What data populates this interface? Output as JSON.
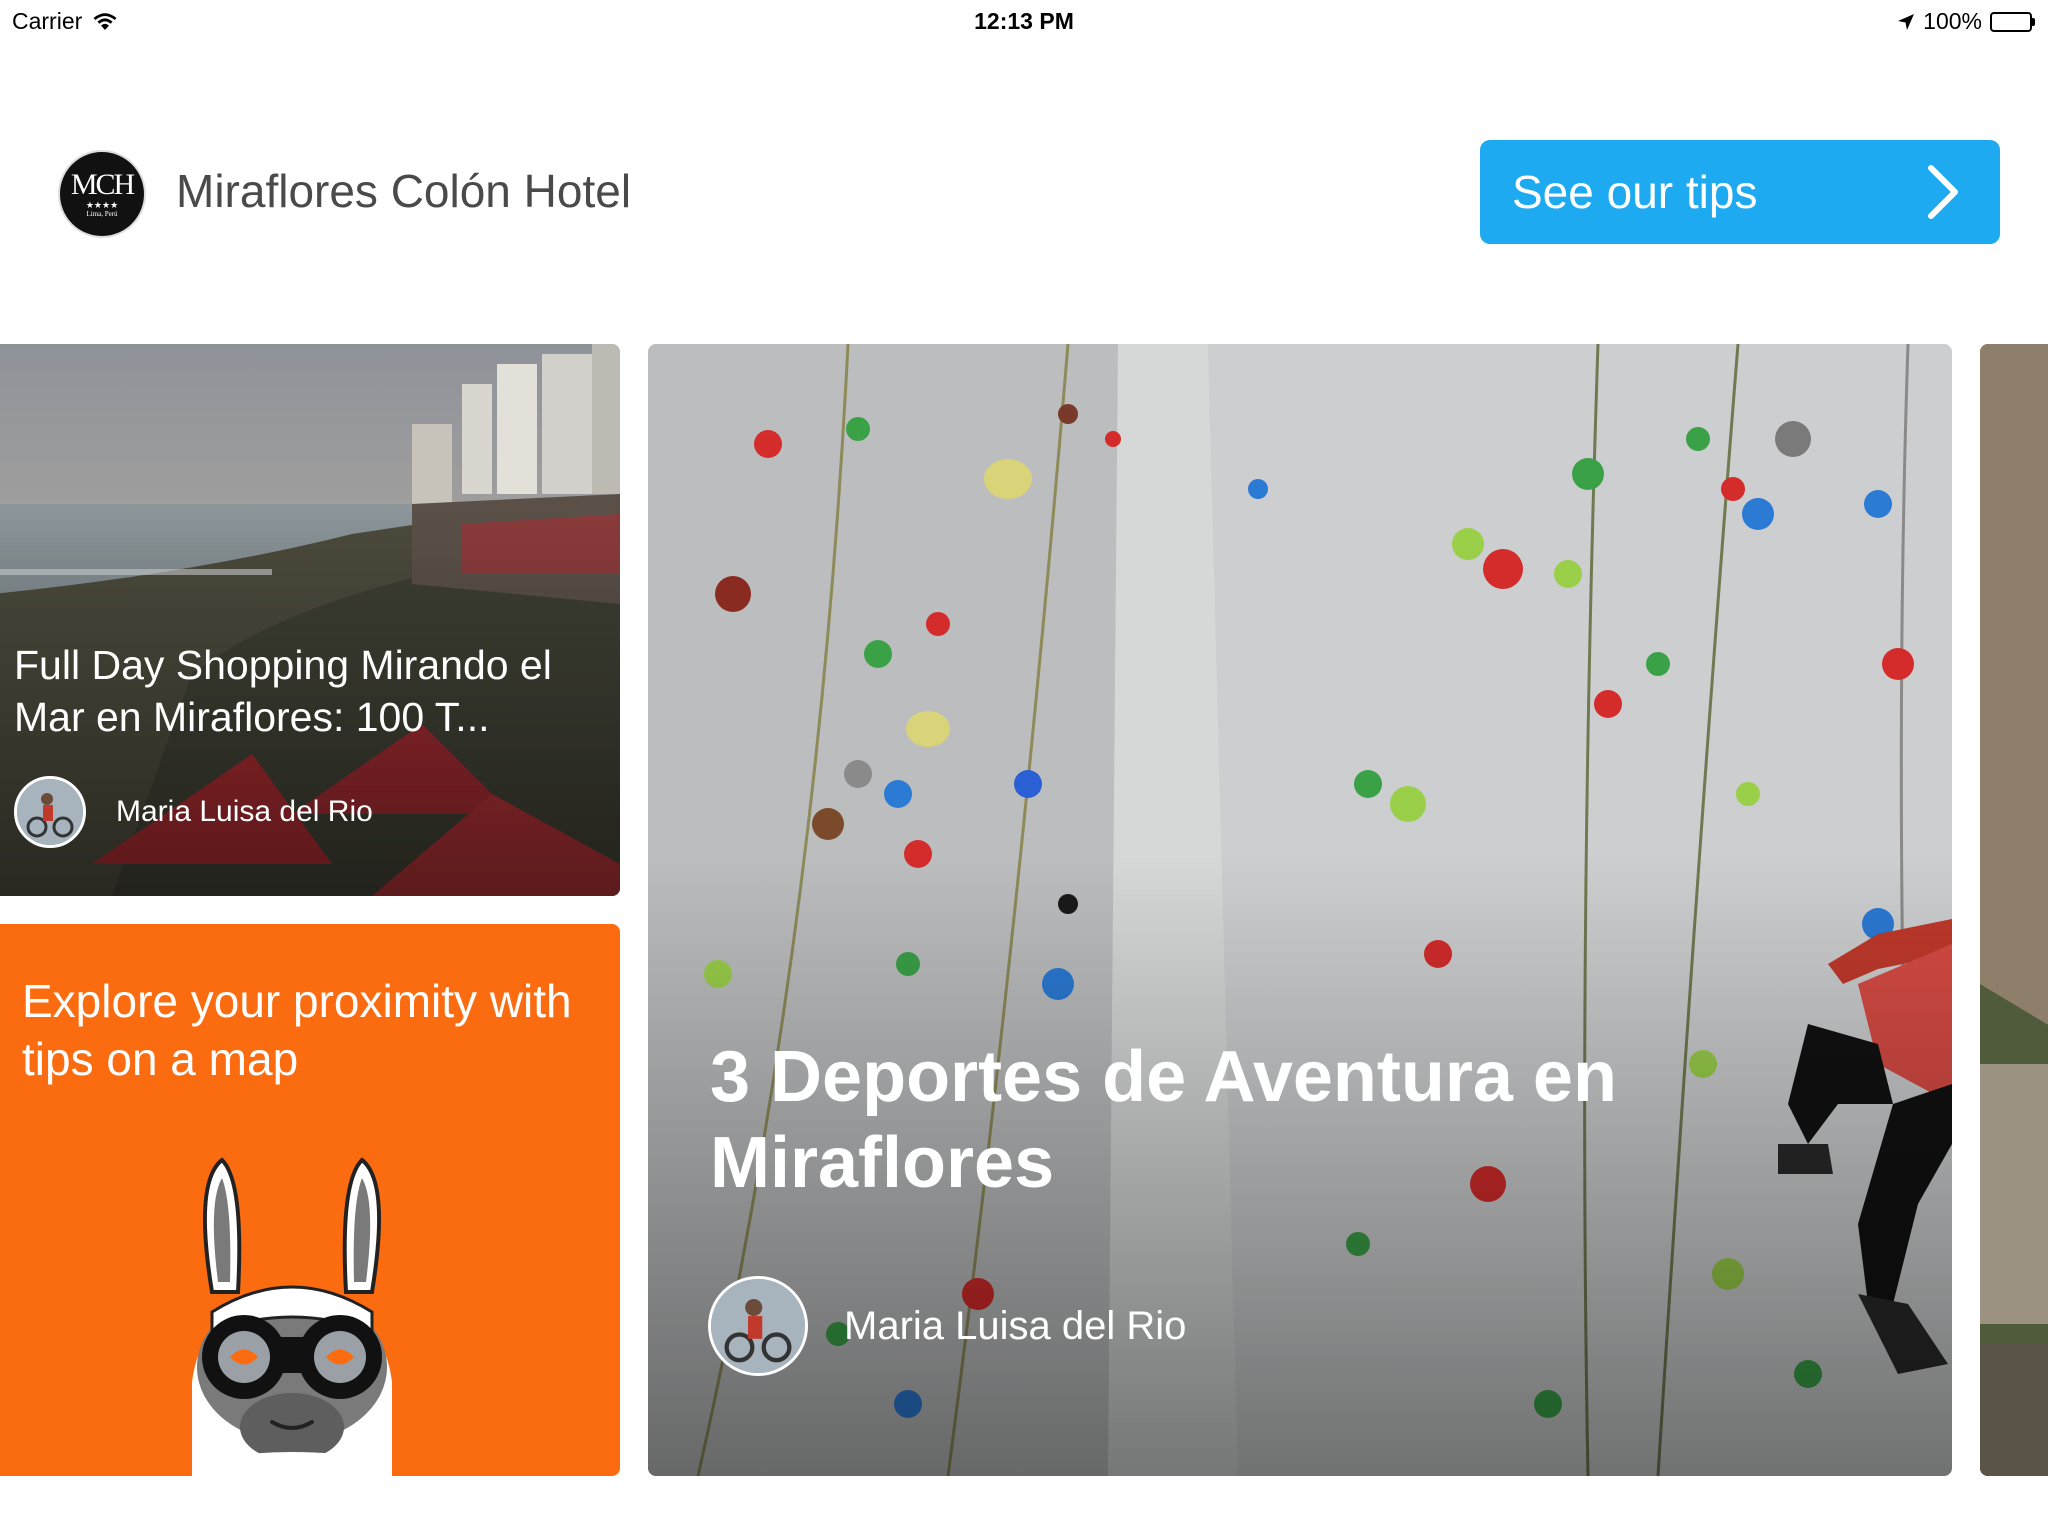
{
  "status_bar": {
    "carrier": "Carrier",
    "time": "12:13 PM",
    "battery": "100%",
    "icons": [
      "wifi-icon",
      "location-arrow-icon",
      "battery-icon"
    ]
  },
  "header": {
    "hotel_name": "Miraflores Colón Hotel",
    "logo": {
      "monogram": "MCH",
      "stars": "★★★★",
      "city": "Lima, Perú"
    },
    "tips_button_label": "See our tips",
    "tips_button_color": "#1eaaf1"
  },
  "cards": [
    {
      "title": "Full Day Shopping Mirando el Mar en Miraflores: 100 T...",
      "author": "Maria Luisa del Rio",
      "image": "coastal-cliff-photo"
    },
    {
      "title": "Explore your proximity with tips on a map",
      "background": "#fa6c0f",
      "icon": "llama-binoculars-icon"
    },
    {
      "title": "3 Deportes de Aventura en Miraflores",
      "author": "Maria Luisa del Rio",
      "image": "climbing-wall-photo"
    },
    {
      "image": "mountain-photo-partial"
    }
  ]
}
